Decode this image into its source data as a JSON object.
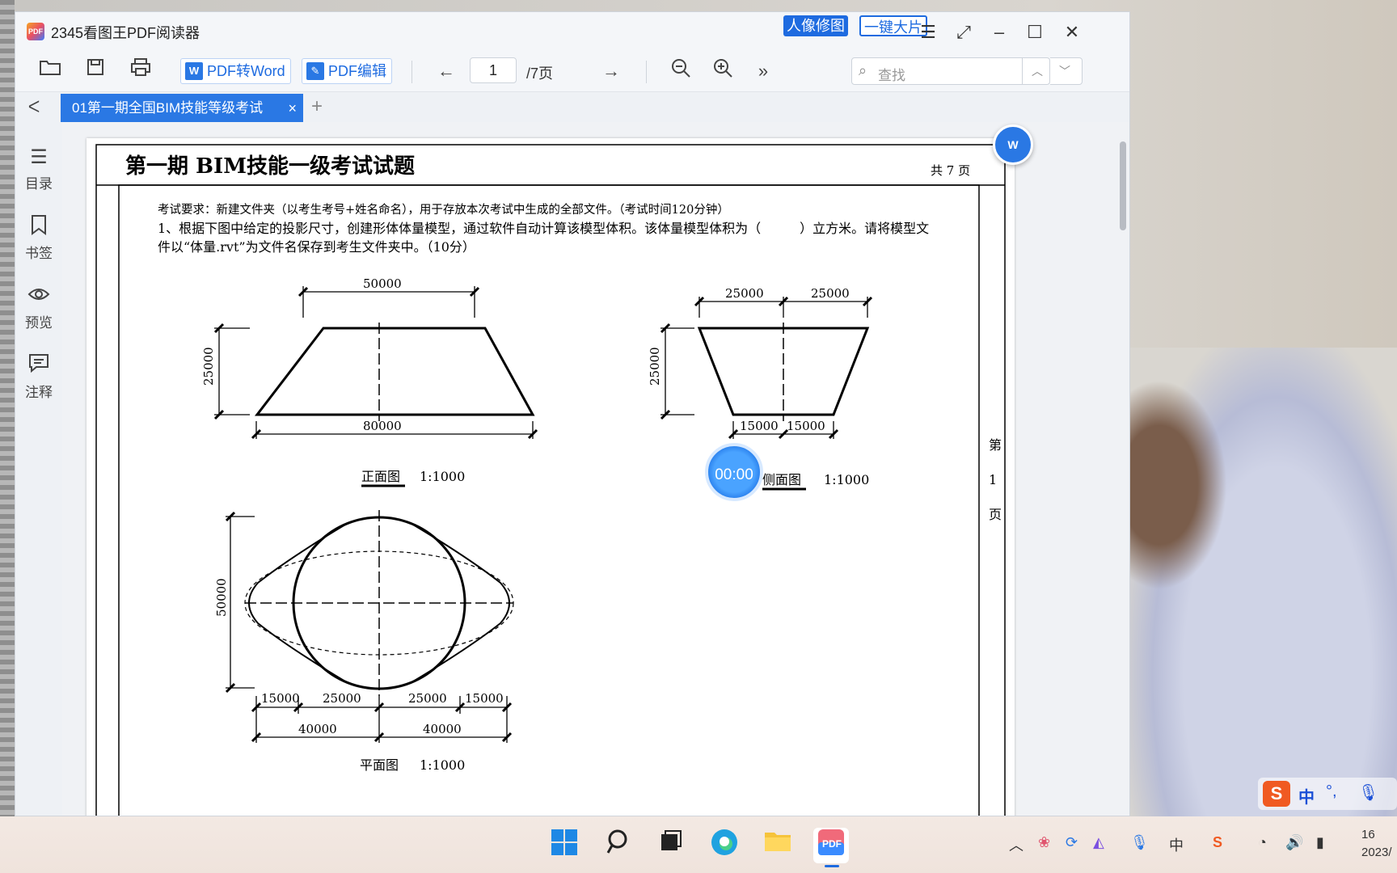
{
  "app": {
    "title": "2345看图王PDF阅读器",
    "logo_text": "PDF",
    "btn_portrait": "人像修图",
    "btn_bigshot": "一键大片"
  },
  "toolbar": {
    "pdf_to_word": "PDF转Word",
    "pdf_edit": "PDF编辑",
    "page_current": "1",
    "page_total": "/7页",
    "search_placeholder": "查找",
    "more": "»"
  },
  "tabs": {
    "active_label": "01第一期全国BIM技能等级考试",
    "close": "×",
    "add": "+"
  },
  "sidebar": {
    "items": [
      {
        "label": "目录",
        "icon": "toc-icon"
      },
      {
        "label": "书签",
        "icon": "bookmark-icon"
      },
      {
        "label": "预览",
        "icon": "eye-icon"
      },
      {
        "label": "注释",
        "icon": "comment-icon"
      }
    ]
  },
  "document": {
    "title": "第一期 BIM技能一级考试试题",
    "page_count": "共 7 页",
    "requirement": "考试要求：新建文件夹（以考生考号+姓名命名），用于存放本次考试中生成的全部文件。（考试时间120分钟）",
    "q1_line1": "1、根据下图中给定的投影尺寸，创建形体体量模型，通过软件自动计算该模型体积。该体量模型体积为（　　　）立方米。请将模型文",
    "q1_line2": "件以“体量.rvt”为文件名保存到考生文件夹中。（10分）",
    "side_page_1": "第",
    "side_page_2": "1",
    "side_page_3": "页",
    "front": {
      "top_dim": "50000",
      "bottom_dim": "80000",
      "height_dim": "25000",
      "name": "正面图",
      "scale": "1:1000"
    },
    "side": {
      "top_left": "25000",
      "top_right": "25000",
      "bottom_left": "15000",
      "bottom_right": "15000",
      "height_dim": "25000",
      "name": "侧面图",
      "scale": "1:1000"
    },
    "plan": {
      "height_dim": "50000",
      "d1": "15000",
      "d2": "25000",
      "d3": "25000",
      "d4": "15000",
      "d5": "40000",
      "d6": "40000",
      "name": "平面图",
      "scale": "1:1000"
    }
  },
  "overlay": {
    "timer": "00:00",
    "word_float": "W"
  },
  "taskbar": {
    "ime_lang": "中",
    "clock_time": "16",
    "clock_date": "2023/"
  }
}
